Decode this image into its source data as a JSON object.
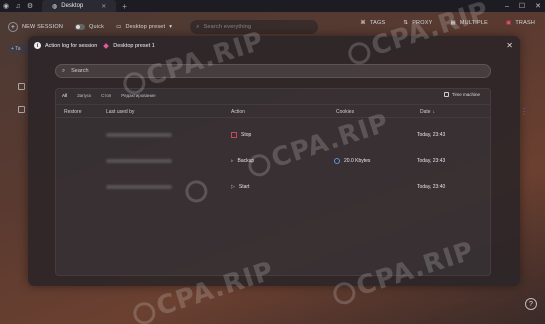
{
  "titlebar": {
    "tab_title": "Desktop"
  },
  "toolbar": {
    "new_session": "NEW SESSION",
    "quick": "Quick",
    "preset": "Desktop preset",
    "search_placeholder": "Search everything",
    "tags": "TAGS",
    "proxy": "PROXY",
    "multiple": "MULTIPLE",
    "trash": "TRASH"
  },
  "modal": {
    "title": "Action log for session",
    "session_name": "Desktop preset 1",
    "search_placeholder": "Search",
    "filters": [
      "All",
      "Запуск",
      "Стоп",
      "Редактирование"
    ],
    "time_machine": "Time machine",
    "columns": {
      "restore": "Restore",
      "last_used_by": "Last used by",
      "action": "Action",
      "cookies": "Cookies",
      "date": "Date"
    },
    "rows": [
      {
        "action": "Stop",
        "action_color": "#e25563",
        "cookies": "",
        "date": "Today, 23:43"
      },
      {
        "action": "Backup",
        "action_color": "#cfcfd6",
        "cookies": "20.0 Kbytes",
        "date": "Today, 23:43"
      },
      {
        "action": "Start",
        "action_color": "#cfcfd6",
        "cookies": "",
        "date": "Today, 23:40"
      }
    ]
  },
  "watermark": "CPA.RIP",
  "colors": {
    "accent": "#7a6fff",
    "stop": "#e25563",
    "cookie_icon": "#6ea8ff"
  }
}
